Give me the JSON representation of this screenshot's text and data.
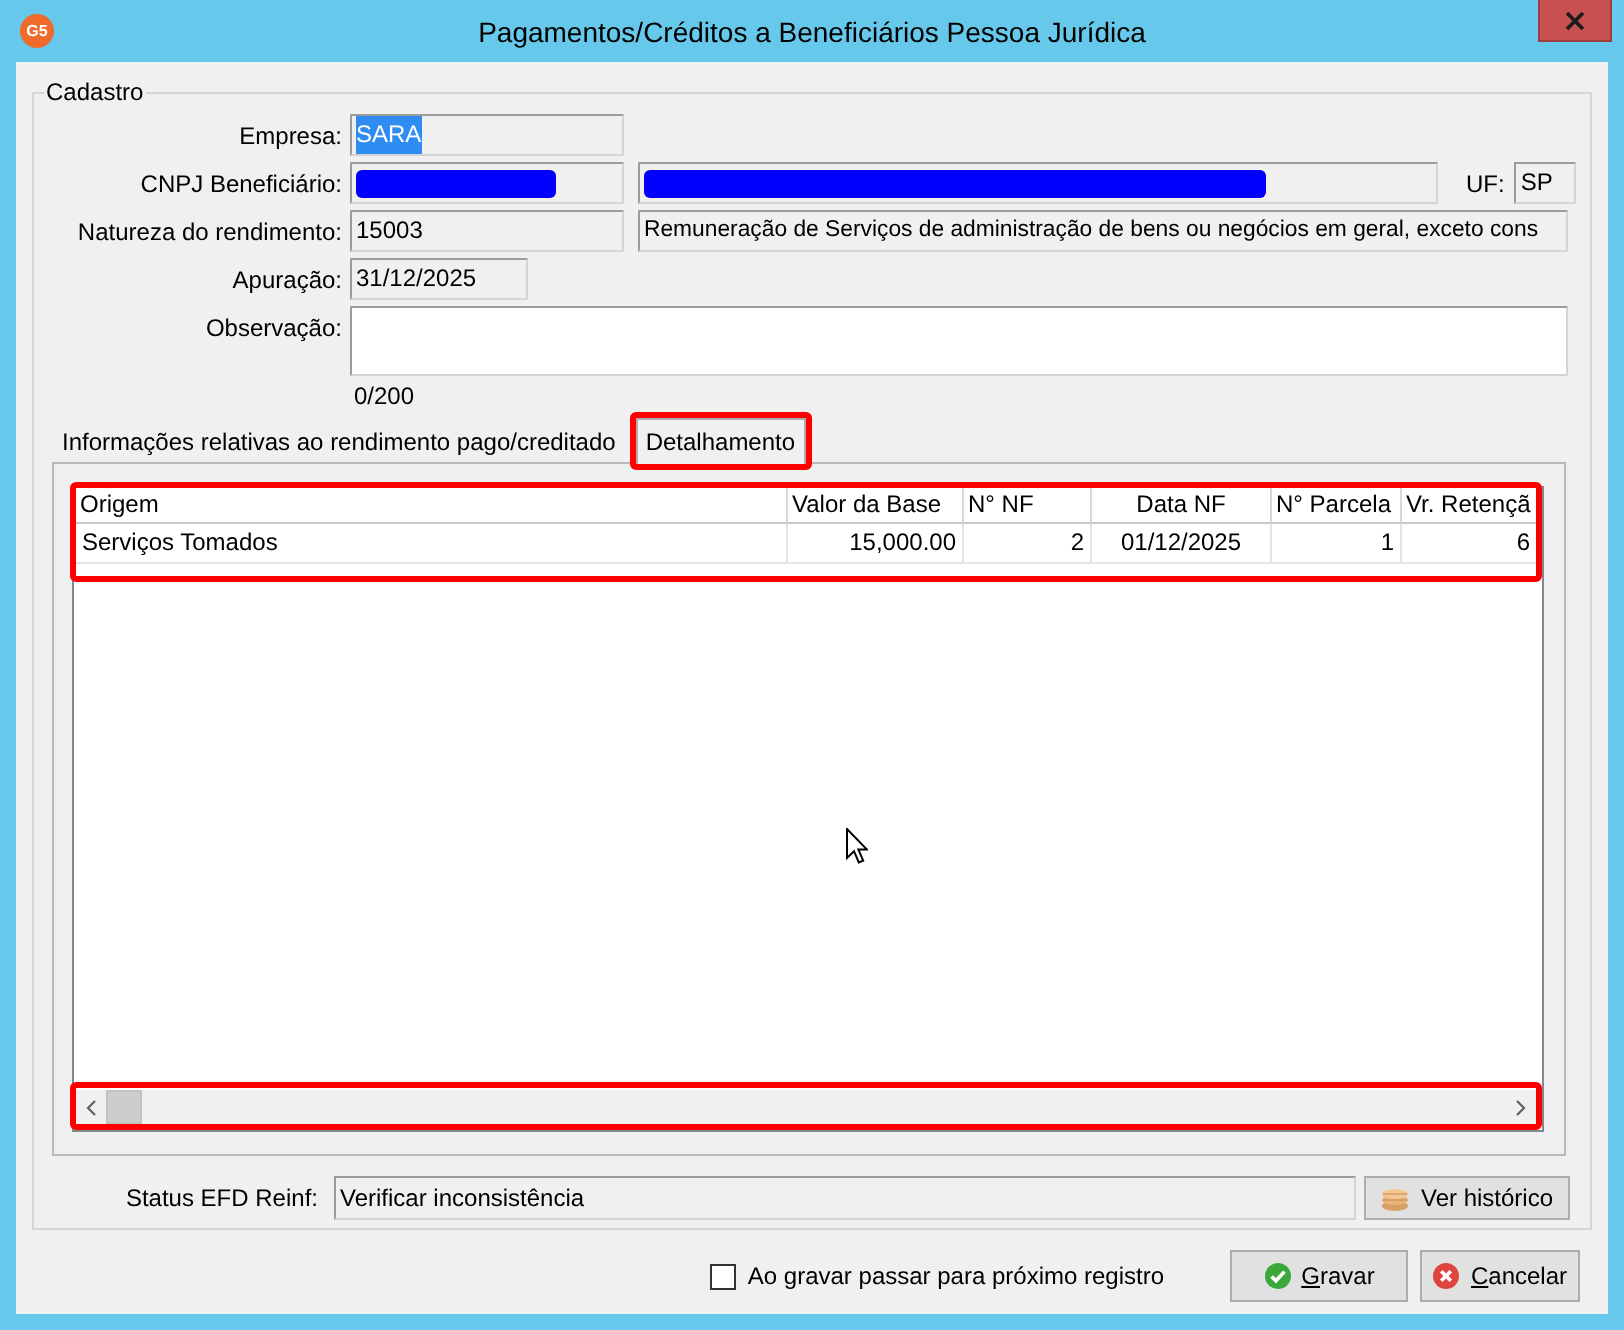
{
  "window": {
    "app_icon_text": "G5",
    "title": "Pagamentos/Créditos a Beneficiários Pessoa Jurídica"
  },
  "group": {
    "title": "Cadastro"
  },
  "form": {
    "empresa": {
      "label": "Empresa:",
      "value": "SARA",
      "text_selected": true
    },
    "cnpj": {
      "label": "CNPJ Beneficiário:",
      "number": {
        "redacted": true
      },
      "name": {
        "redacted": true
      },
      "uf_label": "UF:",
      "uf": "SP"
    },
    "natureza": {
      "label": "Natureza do rendimento:",
      "code": "15003",
      "description": "Remuneração de Serviços de administração de bens ou negócios em geral, exceto cons"
    },
    "apuracao": {
      "label": "Apuração:",
      "value": "31/12/2025"
    },
    "observacao": {
      "label": "Observação:",
      "counter": "0/200"
    }
  },
  "tabs": [
    {
      "label": "Informações relativas ao rendimento pago/creditado",
      "selected": false,
      "highlighted": false
    },
    {
      "label": "Detalhamento",
      "selected": true,
      "highlighted": true
    }
  ],
  "table": {
    "highlighted": true,
    "columns": [
      {
        "label": "Origem",
        "kind": "text"
      },
      {
        "label": "Valor da Base",
        "kind": "number"
      },
      {
        "label": "N° NF",
        "kind": "number"
      },
      {
        "label": "Data NF",
        "kind": "date"
      },
      {
        "label": "N° Parcela",
        "kind": "number"
      },
      {
        "label": "Vr. Retençã",
        "kind": "number"
      }
    ],
    "rows": [
      [
        "Serviços Tomados",
        "15,000.00",
        "2",
        "01/12/2025",
        "1",
        "6"
      ]
    ],
    "scrollbar": {
      "highlighted": true
    }
  },
  "status": {
    "label": "Status EFD Reinf:",
    "value": "Verificar inconsistência",
    "button": "Ver histórico"
  },
  "footer": {
    "checkbox": {
      "label": "Ao gravar passar para próximo registro",
      "checked": false
    },
    "buttons": [
      {
        "label": "Gravar",
        "kind": "save"
      },
      {
        "label": "Cancelar",
        "kind": "cancel"
      }
    ]
  }
}
